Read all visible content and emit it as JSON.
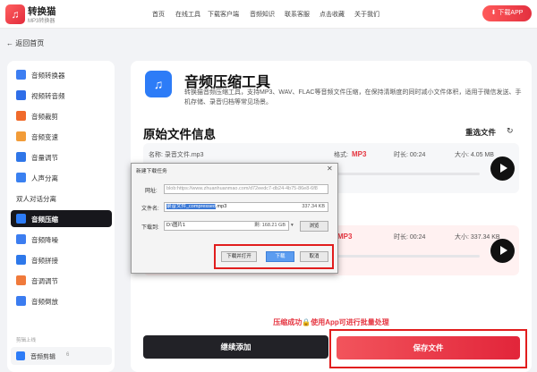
{
  "app": {
    "title": "转换猫",
    "subtitle": "MP3转换器",
    "logo_glyph": "♫"
  },
  "nav": [
    "首页",
    "在线工具",
    "下载客户端",
    "音频知识",
    "联系客服",
    "点击收藏",
    "关于我们"
  ],
  "download_button": {
    "icon": "⬇",
    "label": "下载APP"
  },
  "back": {
    "arrow": "←",
    "label": "返回首页"
  },
  "sidebar": {
    "items": [
      {
        "label": "音频转换器",
        "color": "#3d7ef2"
      },
      {
        "label": "视频转音频",
        "color": "#2f6ee8"
      },
      {
        "label": "音频裁剪",
        "color": "#f06a2b"
      },
      {
        "label": "音频变速",
        "color": "#f29c38"
      },
      {
        "label": "音量调节",
        "color": "#2f76e8"
      },
      {
        "label": "人声分离",
        "color": "#3a80f0"
      },
      {
        "label": "双人对话分离",
        "color": "#7d8aa5"
      },
      {
        "label": "音频压缩",
        "color": "#2d7cf7",
        "active": true
      },
      {
        "label": "音频降噪",
        "color": "#3c7df0"
      },
      {
        "label": "音频拼接",
        "color": "#2e78ea"
      },
      {
        "label": "音调调节",
        "color": "#f07a3b"
      },
      {
        "label": "音频倒放",
        "color": "#3b7cf0"
      }
    ],
    "section_label": "剪辑上线",
    "bottom_item": {
      "label": "音频剪辑",
      "badge": "6"
    }
  },
  "tool": {
    "title": "音频压缩工具",
    "description": "转换猫音频压缩工具，支持MP3、WAV、FLAC等音频文件压缩，在保持清晰度的同时减小文件体积，适用于微信发送、手机存储、录音归档等常见场景。",
    "icon_glyph": "♫"
  },
  "original_section": {
    "title": "原始文件信息",
    "reselect_label": "重选文件",
    "refresh_icon": "↻"
  },
  "original_file": {
    "name_label": "名称:",
    "name": "录音文件.mp3",
    "format_label": "格式:",
    "format": "MP3",
    "duration_label": "时长:",
    "duration": "00:24",
    "size_label": "大小:",
    "size": "4.05 MB",
    "progress": 0.35
  },
  "output_file": {
    "format": "MP3",
    "duration_label": "时长:",
    "duration": "00:24",
    "size_label": "大小:",
    "size": "337.34 KB",
    "progress": 0.35
  },
  "success_message": "压缩成功🔒使用App可进行批量处理",
  "continue_button": "继续添加",
  "save_button": "保存文件",
  "dialog": {
    "title": "新建下载任务",
    "close_icon": "✕",
    "url_label": "网址:",
    "url_value": "blob:https://www.zhuanhuanmao.com/d72eedc7-db24-4b75-86e8-6f8",
    "filename_label": "文件名:",
    "filename_selected": "录音文件_compressed",
    "filename_ext": ".mp3",
    "filename_size": "337.34 KB",
    "path_label": "下载到:",
    "path_value": "D:\\图片1",
    "free_space": "剩: 168.21 GB",
    "dropdown_icon": "▾",
    "browse_label": "浏览",
    "open_after_label": "下载并打开",
    "download_label": "下载",
    "cancel_label": "取消"
  },
  "accent_color": "#e5343f"
}
